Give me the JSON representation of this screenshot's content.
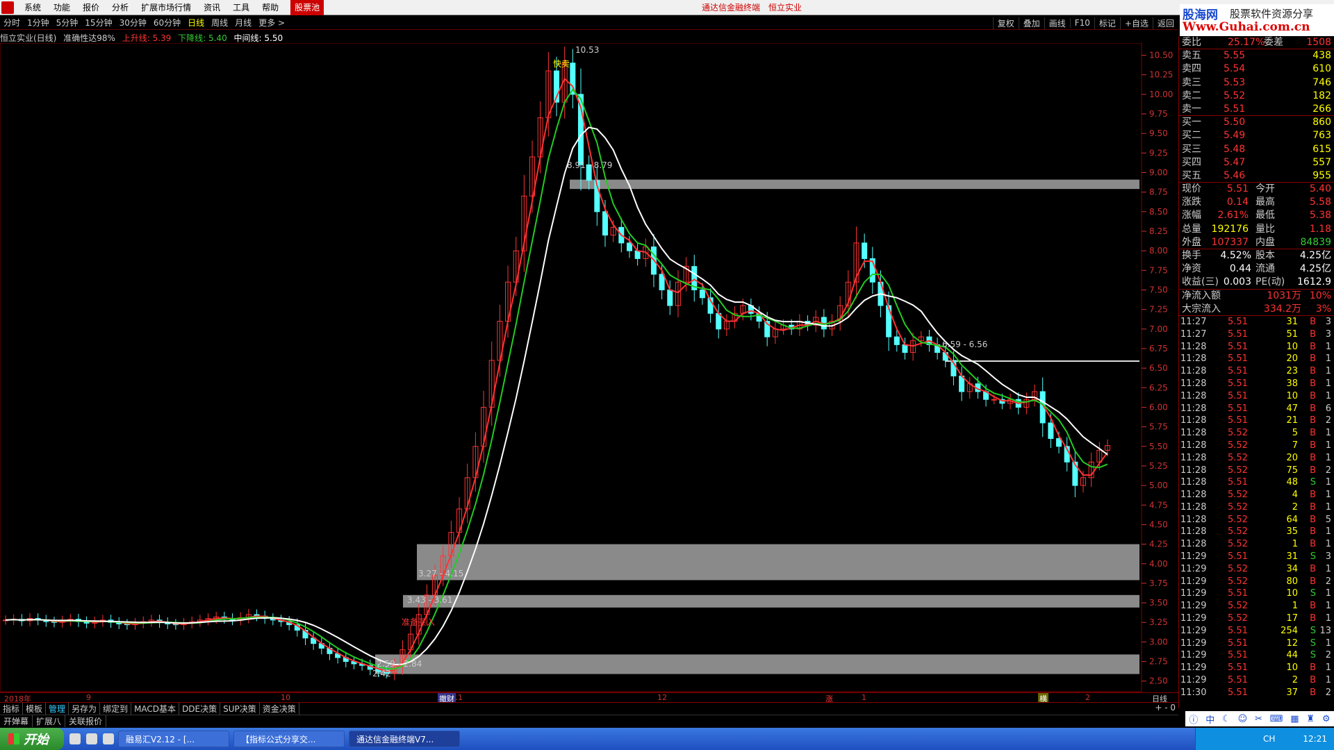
{
  "menu": {
    "items": [
      "系统",
      "功能",
      "报价",
      "分析",
      "扩展市场行情",
      "资讯",
      "工具",
      "帮助"
    ],
    "stock_pool": "股票池",
    "center_title": [
      "通达信金融终端",
      "恒立实业"
    ]
  },
  "brand": {
    "name": "股海网",
    "slogan": "股票软件资源分享",
    "url": "Www.Guhai.com.cn"
  },
  "toolbar": {
    "periods": [
      "分时",
      "1分钟",
      "5分钟",
      "15分钟",
      "30分钟",
      "60分钟",
      "日线",
      "周线",
      "月线",
      "更多 >"
    ],
    "active_index": 6,
    "right_buttons": [
      "复权",
      "叠加",
      "画线",
      "F10",
      "标记",
      "+自选",
      "返回"
    ]
  },
  "indicator": {
    "name": "恒立实业(日线)",
    "accuracy": "准确性达98%",
    "up_label": "上升线: 5.39",
    "down_label": "下降线: 5.40",
    "mid_label": "中间线: 5.50"
  },
  "chart_data": {
    "type": "candlestick",
    "yaxis_ticks": [
      "10.50",
      "10.25",
      "10.00",
      "9.75",
      "9.50",
      "9.25",
      "9.00",
      "8.75",
      "8.50",
      "8.25",
      "8.00",
      "7.75",
      "7.50",
      "7.25",
      "7.00",
      "6.75",
      "6.50",
      "6.25",
      "6.00",
      "5.75",
      "5.50",
      "5.25",
      "5.00",
      "4.75",
      "4.50",
      "4.25",
      "4.00",
      "3.75",
      "3.50",
      "3.25",
      "3.00",
      "2.75",
      "2.50"
    ],
    "ylim": [
      2.4,
      10.62
    ],
    "annotations": {
      "high": "10.53",
      "low": "2.42",
      "sell": "快卖",
      "buy": "准备买入",
      "z1": "8.91 - 8.79",
      "z2": "3.27 - 4.15",
      "z3": "3.43 - 3.61",
      "z4": "2.59 - 2.84",
      "z5": "6.59 - 6.56"
    },
    "zones": [
      [
        8.79,
        8.91
      ],
      [
        3.79,
        4.25
      ],
      [
        3.44,
        3.6
      ],
      [
        2.59,
        2.84
      ]
    ],
    "hline": 6.59,
    "closes": [
      3.28,
      3.29,
      3.27,
      3.3,
      3.28,
      3.26,
      3.25,
      3.27,
      3.29,
      3.26,
      3.24,
      3.26,
      3.28,
      3.25,
      3.23,
      3.22,
      3.24,
      3.26,
      3.28,
      3.25,
      3.23,
      3.22,
      3.24,
      3.26,
      3.28,
      3.3,
      3.32,
      3.3,
      3.28,
      3.31,
      3.35,
      3.33,
      3.3,
      3.28,
      3.26,
      3.22,
      3.15,
      3.05,
      2.98,
      2.92,
      2.85,
      2.8,
      2.75,
      2.72,
      2.7,
      2.65,
      2.62,
      2.6,
      2.7,
      2.9,
      3.1,
      3.35,
      3.6,
      3.85,
      4.1,
      4.4,
      4.7,
      5.1,
      5.5,
      6.0,
      6.6,
      7.1,
      7.6,
      8.0,
      8.7,
      9.2,
      9.7,
      10.3,
      9.9,
      10.4,
      10.0,
      9.1,
      8.9,
      8.5,
      8.2,
      8.3,
      8.1,
      8.0,
      7.9,
      8.05,
      7.7,
      7.5,
      7.3,
      7.6,
      7.8,
      7.5,
      7.4,
      7.2,
      7.0,
      7.1,
      7.2,
      7.3,
      7.2,
      7.1,
      6.9,
      7.0,
      7.05,
      7.0,
      7.1,
      7.05,
      7.15,
      7.0,
      7.1,
      7.3,
      7.6,
      8.1,
      7.9,
      7.6,
      7.3,
      6.9,
      6.8,
      6.7,
      6.85,
      6.9,
      6.8,
      6.7,
      6.6,
      6.4,
      6.2,
      6.3,
      6.2,
      6.1,
      6.1,
      6.05,
      6.1,
      6.0,
      6.1,
      6.2,
      5.8,
      5.6,
      5.5,
      5.3,
      5.0,
      5.1,
      5.3,
      5.45,
      5.51
    ],
    "xaxis_labels": [
      "2018年",
      "9",
      "10",
      "11",
      "12",
      "1",
      "2"
    ],
    "period_label": "日线",
    "markers": [
      "撤财",
      "涨",
      "横"
    ]
  },
  "quote": {
    "wb": "委比",
    "wb_val": "25.17%",
    "wc": "委差",
    "wc_val": "1508",
    "asks": [
      [
        "卖五",
        "5.55",
        "438"
      ],
      [
        "卖四",
        "5.54",
        "610"
      ],
      [
        "卖三",
        "5.53",
        "746"
      ],
      [
        "卖二",
        "5.52",
        "182"
      ],
      [
        "卖一",
        "5.51",
        "266"
      ]
    ],
    "bids": [
      [
        "买一",
        "5.50",
        "860"
      ],
      [
        "买二",
        "5.49",
        "763"
      ],
      [
        "买三",
        "5.48",
        "615"
      ],
      [
        "买四",
        "5.47",
        "557"
      ],
      [
        "买五",
        "5.46",
        "955"
      ]
    ],
    "stats": [
      [
        "现价",
        "5.51",
        "今开",
        "5.40"
      ],
      [
        "涨跌",
        "0.14",
        "最高",
        "5.58"
      ],
      [
        "涨幅",
        "2.61%",
        "最低",
        "5.38"
      ],
      [
        "总量",
        "192176",
        "量比",
        "1.18"
      ],
      [
        "外盘",
        "107337",
        "内盘",
        "84839"
      ]
    ],
    "stats2": [
      [
        "换手",
        "4.52%",
        "股本",
        "4.25亿"
      ],
      [
        "净资",
        "0.44",
        "流通",
        "4.25亿"
      ],
      [
        "收益(三)",
        "0.003",
        "PE(动)",
        "1612.9"
      ]
    ],
    "flows": [
      [
        "净流入额",
        "1031万",
        "10%"
      ],
      [
        "大宗流入",
        "334.2万",
        "3%"
      ]
    ]
  },
  "ticks": [
    [
      "11:27",
      "5.51",
      "31",
      "B",
      "3"
    ],
    [
      "11:27",
      "5.51",
      "51",
      "B",
      "3"
    ],
    [
      "11:28",
      "5.51",
      "10",
      "B",
      "1"
    ],
    [
      "11:28",
      "5.51",
      "20",
      "B",
      "1"
    ],
    [
      "11:28",
      "5.51",
      "23",
      "B",
      "1"
    ],
    [
      "11:28",
      "5.51",
      "38",
      "B",
      "1"
    ],
    [
      "11:28",
      "5.51",
      "10",
      "B",
      "1"
    ],
    [
      "11:28",
      "5.51",
      "47",
      "B",
      "6"
    ],
    [
      "11:28",
      "5.51",
      "21",
      "B",
      "2"
    ],
    [
      "11:28",
      "5.52",
      "5",
      "B",
      "1"
    ],
    [
      "11:28",
      "5.52",
      "7",
      "B",
      "1"
    ],
    [
      "11:28",
      "5.52",
      "20",
      "B",
      "1"
    ],
    [
      "11:28",
      "5.52",
      "75",
      "B",
      "2"
    ],
    [
      "11:28",
      "5.51",
      "48",
      "S",
      "1"
    ],
    [
      "11:28",
      "5.52",
      "4",
      "B",
      "1"
    ],
    [
      "11:28",
      "5.52",
      "2",
      "B",
      "1"
    ],
    [
      "11:28",
      "5.52",
      "64",
      "B",
      "5"
    ],
    [
      "11:28",
      "5.52",
      "35",
      "B",
      "1"
    ],
    [
      "11:28",
      "5.52",
      "1",
      "B",
      "1"
    ],
    [
      "11:29",
      "5.51",
      "31",
      "S",
      "3"
    ],
    [
      "11:29",
      "5.52",
      "34",
      "B",
      "1"
    ],
    [
      "11:29",
      "5.52",
      "80",
      "B",
      "2"
    ],
    [
      "11:29",
      "5.51",
      "10",
      "S",
      "1"
    ],
    [
      "11:29",
      "5.52",
      "1",
      "B",
      "1"
    ],
    [
      "11:29",
      "5.52",
      "17",
      "B",
      "1"
    ],
    [
      "11:29",
      "5.51",
      "254",
      "S",
      "13"
    ],
    [
      "11:29",
      "5.51",
      "12",
      "S",
      "1"
    ],
    [
      "11:29",
      "5.51",
      "44",
      "S",
      "2"
    ],
    [
      "11:29",
      "5.51",
      "10",
      "B",
      "1"
    ],
    [
      "11:29",
      "5.51",
      "2",
      "B",
      "1"
    ],
    [
      "11:30",
      "5.51",
      "37",
      "B",
      "2"
    ]
  ],
  "bottom_tabs": [
    "指标",
    "模板",
    "管理",
    "另存为",
    "绑定到",
    "MACD基本",
    "DDE决策",
    "SUP决策",
    "资金决策"
  ],
  "bottom_tabs_active": 2,
  "bottom_tabs2": [
    "开婵幕",
    "扩展八",
    "关联报价"
  ],
  "zoom": "+ - 0",
  "taskbar": {
    "start": "开始",
    "tasks": [
      "融易汇V2.12 - [...",
      "【指标公式分享交...",
      "通达信金融终端V7..."
    ],
    "active_task": 2,
    "ime": "CH",
    "clock": "12:21"
  },
  "colors": {
    "up": "#ff3333",
    "down": "#54ffff",
    "mid": "#ffffff",
    "green": "#22cc22"
  }
}
